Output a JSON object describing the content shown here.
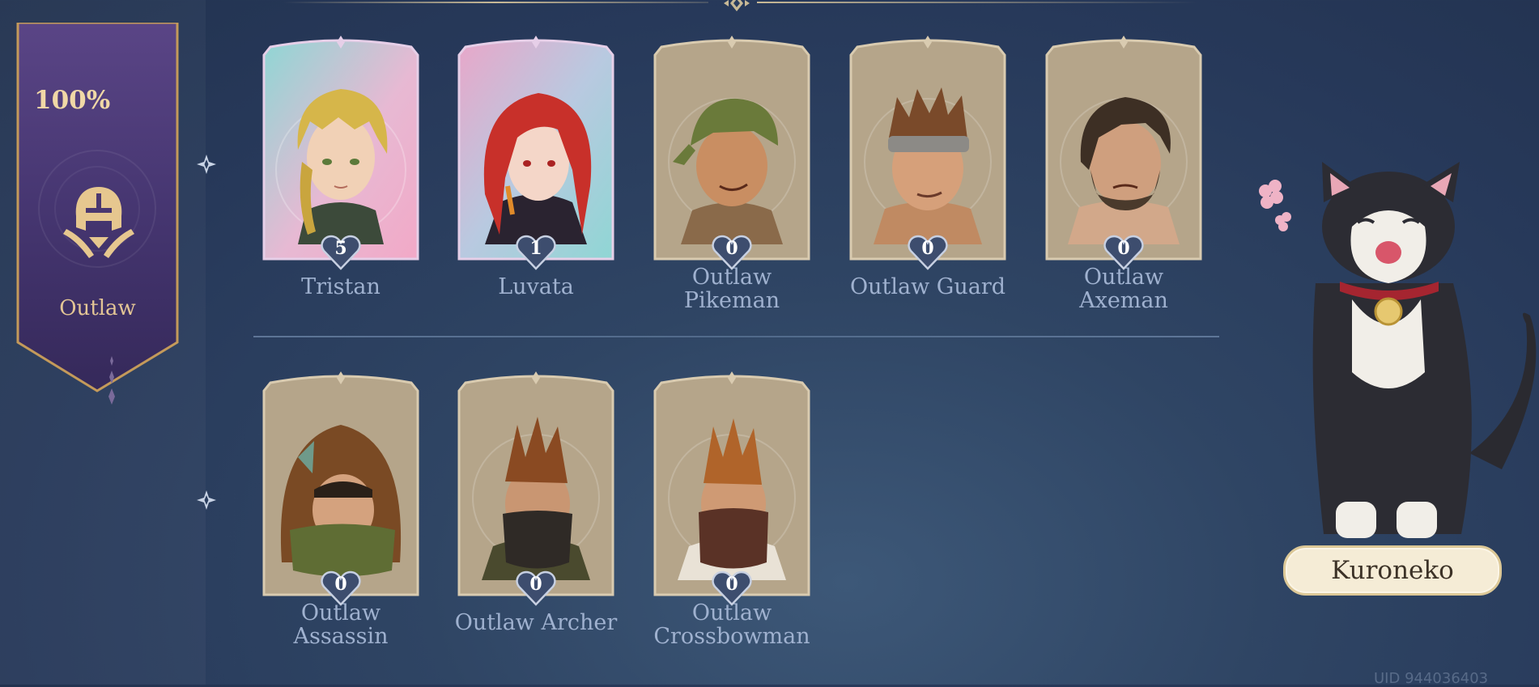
{
  "faction": {
    "percent": "100%",
    "name": "Outlaw",
    "emblem_icon": "helmet-crossed-swords-icon"
  },
  "cards_row1": [
    {
      "name": "Tristan",
      "count": "5",
      "style": "rare"
    },
    {
      "name": "Luvata",
      "count": "1",
      "style": "rare"
    },
    {
      "name": "Outlaw\nPikeman",
      "count": "0",
      "style": "common"
    },
    {
      "name": "Outlaw Guard",
      "count": "0",
      "style": "common"
    },
    {
      "name": "Outlaw\nAxeman",
      "count": "0",
      "style": "common"
    }
  ],
  "cards_row2": [
    {
      "name": "Outlaw\nAssassin",
      "count": "0",
      "style": "common"
    },
    {
      "name": "Outlaw Archer",
      "count": "0",
      "style": "common"
    },
    {
      "name": "Outlaw\nCrossbowman",
      "count": "0",
      "style": "common"
    }
  ],
  "companion": {
    "name": "Kuroneko"
  },
  "uid": "UID 944036403",
  "colors": {
    "background": "#2a3d5e",
    "banner": "#4a3870",
    "banner_border": "#c8a062",
    "card_common": "#b5a58a",
    "card_frame": "#8d7b62",
    "heart": "#3d4d6e",
    "name_text": "#9fb1cf",
    "percent_text": "#f0d8a6"
  }
}
